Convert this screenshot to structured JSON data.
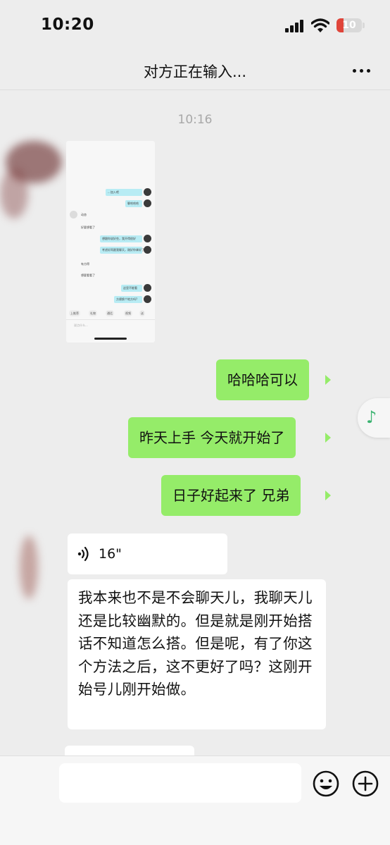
{
  "status_bar": {
    "time": "10:20",
    "battery": "10"
  },
  "header": {
    "title": "对方正在输入..."
  },
  "chat": {
    "timestamp": "10:16",
    "messages_out": [
      "哈哈哈可以",
      "昨天上手 今天就开始了",
      "日子好起来了 兄弟"
    ],
    "voice": {
      "duration": "16\""
    },
    "long_message": "我本来也不是不会聊天儿，我聊天儿还是比较幽默的。但是就是刚开始搭话不知道怎么搭。但是呢，有了你这个方法之后，这不更好了吗？这刚开始号儿刚开始做。"
  },
  "thumbnail": {
    "rows": [
      {
        "side": "out",
        "text": "...加入吧"
      },
      {
        "side": "out",
        "text": "聊哈哈哈"
      },
      {
        "side": "in",
        "text": "动态"
      },
      {
        "side": "in",
        "text": "好要想看了"
      },
      {
        "side": "out",
        "text": "想跟你说好些，我开得很好"
      },
      {
        "side": "out",
        "text": "考虑好再跟我聊天，刚好你拿好了"
      },
      {
        "side": "in",
        "text": "有方得"
      },
      {
        "side": "in",
        "text": "想要看看了"
      },
      {
        "side": "out",
        "text": "这里不能看"
      },
      {
        "side": "out",
        "text": "方便换个地方吗?"
      }
    ],
    "chips": [
      "上推荐",
      "礼物",
      "通话",
      "视频",
      "送"
    ],
    "input_placeholder": "说点什么..."
  },
  "colors": {
    "out_bubble": "#95ec69",
    "in_bubble": "#ffffff",
    "background": "#ededed",
    "music_accent": "#3cb371"
  },
  "icons": {
    "more": "more-icon",
    "music": "music-note-icon",
    "emoji": "emoji-icon",
    "plus": "plus-icon",
    "voice": "voice-wave-icon"
  }
}
